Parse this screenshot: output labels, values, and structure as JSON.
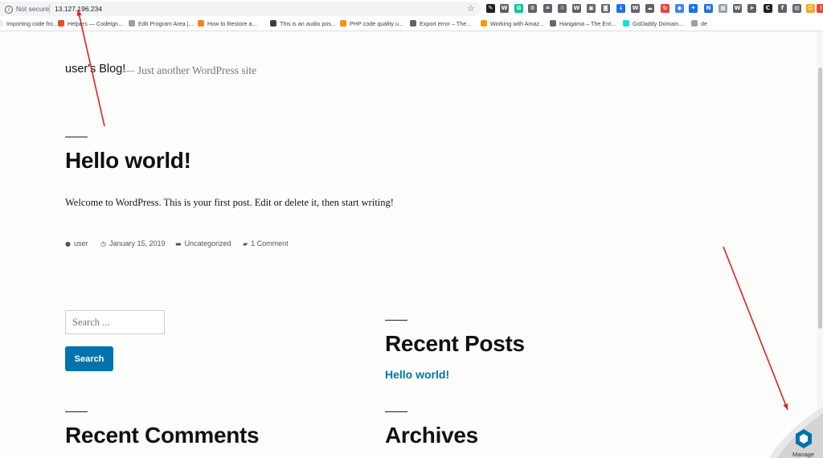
{
  "browser": {
    "security_label": "Not secure",
    "url": "13.127.196.234",
    "bookmarks": [
      {
        "label": "Importing code fro...",
        "color": "#e8eaed"
      },
      {
        "label": "Helpers — CodeIgn...",
        "color": "#e44d26"
      },
      {
        "label": "Edit Program Area |...",
        "color": "#9aa0a6"
      },
      {
        "label": "How to Restore a...",
        "color": "#f58220"
      },
      {
        "label": "This is an audio pos...",
        "color": "#3c4043"
      },
      {
        "label": "PHP code quality u...",
        "color": "#f29111"
      },
      {
        "label": "Export error – The...",
        "color": "#5f6368"
      },
      {
        "label": "Working with Amaz...",
        "color": "#ff9900"
      },
      {
        "label": "Hangama – The Ent...",
        "color": "#6a6a6a"
      },
      {
        "label": "GoDaddy Domain...",
        "color": "#1bdbdb"
      },
      {
        "label": "de",
        "color": "#9aa0a6"
      }
    ],
    "extensions": [
      {
        "icon": "pen-icon",
        "color": "#202124",
        "glyph": "✎"
      },
      {
        "icon": "wave-icon",
        "color": "#5f6368",
        "glyph": "W"
      },
      {
        "icon": "grammarly-icon",
        "color": "#15c39a",
        "glyph": "G"
      },
      {
        "icon": "gear-icon",
        "color": "#5f6368",
        "glyph": "⚙"
      },
      {
        "icon": "crop-icon",
        "color": "#5f6368",
        "glyph": "⌗"
      },
      {
        "icon": "recycle-icon",
        "color": "#5f6368",
        "glyph": "♲"
      },
      {
        "icon": "wordpress-icon",
        "color": "#5f6368",
        "glyph": "W"
      },
      {
        "icon": "lock-icon",
        "color": "#5f6368",
        "glyph": "▣"
      },
      {
        "icon": "camera-icon",
        "color": "#5f6368",
        "glyph": "◙"
      },
      {
        "icon": "download-icon",
        "color": "#1a73e8",
        "glyph": "↓"
      },
      {
        "icon": "wordpress-icon",
        "color": "#5f6368",
        "glyph": "W"
      },
      {
        "icon": "cloud-icon",
        "color": "#5f6368",
        "glyph": "☁"
      },
      {
        "icon": "arrows-icon",
        "color": "#e8453c",
        "glyph": "↻"
      },
      {
        "icon": "diamond-icon",
        "color": "#4285f4",
        "glyph": "◆"
      },
      {
        "icon": "share-icon",
        "color": "#1a73e8",
        "glyph": "✦"
      },
      {
        "icon": "new-icon",
        "color": "#1a73e8",
        "glyph": "N"
      },
      {
        "icon": "grid-icon",
        "color": "#9aa0a6",
        "glyph": "▦"
      },
      {
        "icon": "wordpress-icon",
        "color": "#5f6368",
        "glyph": "W"
      },
      {
        "icon": "send-icon",
        "color": "#5f6368",
        "glyph": "➤"
      },
      {
        "icon": "c-icon",
        "color": "#202124",
        "glyph": "C"
      },
      {
        "icon": "facebook-icon",
        "color": "#5f6368",
        "glyph": "f"
      },
      {
        "icon": "image-icon",
        "color": "#5f6368",
        "glyph": "▤"
      },
      {
        "icon": "smiley-icon",
        "color": "#f5a623",
        "glyph": "☺"
      },
      {
        "icon": "menu-icon",
        "color": "#e8453c",
        "glyph": "⋮"
      }
    ]
  },
  "site": {
    "title": "user's Blog!",
    "tagline": "— Just another WordPress site"
  },
  "post": {
    "title": "Hello world!",
    "body": "Welcome to WordPress. This is your first post. Edit or delete it, then start writing!",
    "author": "user",
    "date": "January 15, 2019",
    "category": "Uncategorized",
    "comments": "1 Comment"
  },
  "search": {
    "placeholder": "Search ...",
    "button_label": "Search"
  },
  "widgets": {
    "recent_posts_title": "Recent Posts",
    "recent_posts": [
      "Hello world!"
    ],
    "recent_comments_title": "Recent Comments",
    "archives_title": "Archives"
  },
  "manage": {
    "label": "Manage",
    "color": "#0073aa"
  },
  "annotation_color": "#e02020"
}
